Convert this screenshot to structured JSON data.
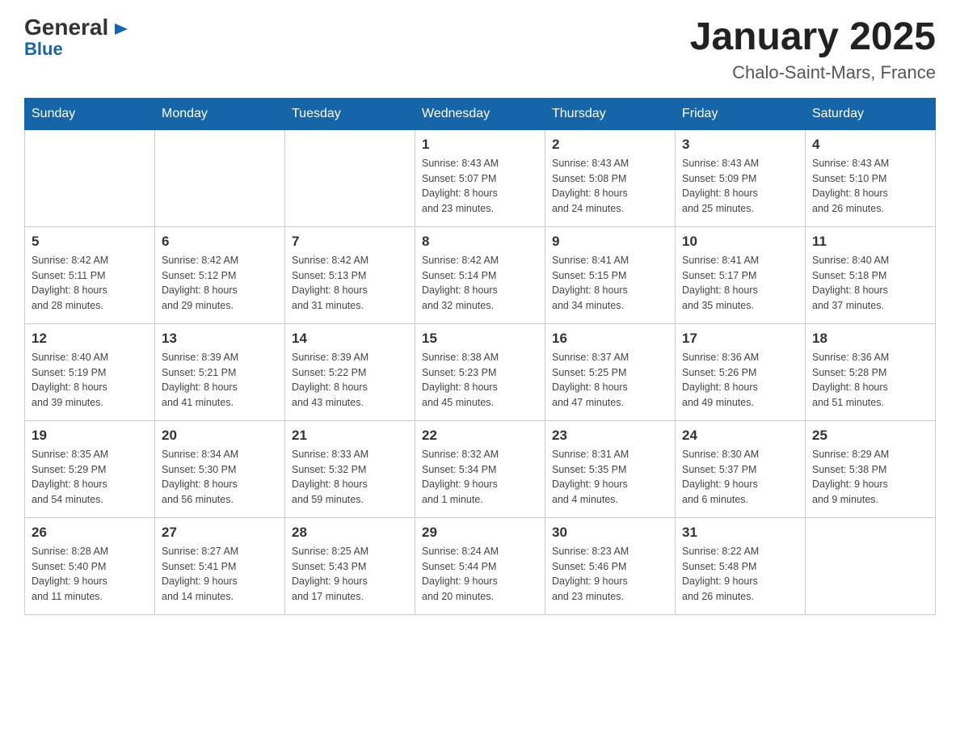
{
  "logo": {
    "general": "General",
    "blue": "Blue",
    "triangle": "▲"
  },
  "title": "January 2025",
  "location": "Chalo-Saint-Mars, France",
  "days_of_week": [
    "Sunday",
    "Monday",
    "Tuesday",
    "Wednesday",
    "Thursday",
    "Friday",
    "Saturday"
  ],
  "weeks": [
    [
      {
        "day": "",
        "info": ""
      },
      {
        "day": "",
        "info": ""
      },
      {
        "day": "",
        "info": ""
      },
      {
        "day": "1",
        "info": "Sunrise: 8:43 AM\nSunset: 5:07 PM\nDaylight: 8 hours\nand 23 minutes."
      },
      {
        "day": "2",
        "info": "Sunrise: 8:43 AM\nSunset: 5:08 PM\nDaylight: 8 hours\nand 24 minutes."
      },
      {
        "day": "3",
        "info": "Sunrise: 8:43 AM\nSunset: 5:09 PM\nDaylight: 8 hours\nand 25 minutes."
      },
      {
        "day": "4",
        "info": "Sunrise: 8:43 AM\nSunset: 5:10 PM\nDaylight: 8 hours\nand 26 minutes."
      }
    ],
    [
      {
        "day": "5",
        "info": "Sunrise: 8:42 AM\nSunset: 5:11 PM\nDaylight: 8 hours\nand 28 minutes."
      },
      {
        "day": "6",
        "info": "Sunrise: 8:42 AM\nSunset: 5:12 PM\nDaylight: 8 hours\nand 29 minutes."
      },
      {
        "day": "7",
        "info": "Sunrise: 8:42 AM\nSunset: 5:13 PM\nDaylight: 8 hours\nand 31 minutes."
      },
      {
        "day": "8",
        "info": "Sunrise: 8:42 AM\nSunset: 5:14 PM\nDaylight: 8 hours\nand 32 minutes."
      },
      {
        "day": "9",
        "info": "Sunrise: 8:41 AM\nSunset: 5:15 PM\nDaylight: 8 hours\nand 34 minutes."
      },
      {
        "day": "10",
        "info": "Sunrise: 8:41 AM\nSunset: 5:17 PM\nDaylight: 8 hours\nand 35 minutes."
      },
      {
        "day": "11",
        "info": "Sunrise: 8:40 AM\nSunset: 5:18 PM\nDaylight: 8 hours\nand 37 minutes."
      }
    ],
    [
      {
        "day": "12",
        "info": "Sunrise: 8:40 AM\nSunset: 5:19 PM\nDaylight: 8 hours\nand 39 minutes."
      },
      {
        "day": "13",
        "info": "Sunrise: 8:39 AM\nSunset: 5:21 PM\nDaylight: 8 hours\nand 41 minutes."
      },
      {
        "day": "14",
        "info": "Sunrise: 8:39 AM\nSunset: 5:22 PM\nDaylight: 8 hours\nand 43 minutes."
      },
      {
        "day": "15",
        "info": "Sunrise: 8:38 AM\nSunset: 5:23 PM\nDaylight: 8 hours\nand 45 minutes."
      },
      {
        "day": "16",
        "info": "Sunrise: 8:37 AM\nSunset: 5:25 PM\nDaylight: 8 hours\nand 47 minutes."
      },
      {
        "day": "17",
        "info": "Sunrise: 8:36 AM\nSunset: 5:26 PM\nDaylight: 8 hours\nand 49 minutes."
      },
      {
        "day": "18",
        "info": "Sunrise: 8:36 AM\nSunset: 5:28 PM\nDaylight: 8 hours\nand 51 minutes."
      }
    ],
    [
      {
        "day": "19",
        "info": "Sunrise: 8:35 AM\nSunset: 5:29 PM\nDaylight: 8 hours\nand 54 minutes."
      },
      {
        "day": "20",
        "info": "Sunrise: 8:34 AM\nSunset: 5:30 PM\nDaylight: 8 hours\nand 56 minutes."
      },
      {
        "day": "21",
        "info": "Sunrise: 8:33 AM\nSunset: 5:32 PM\nDaylight: 8 hours\nand 59 minutes."
      },
      {
        "day": "22",
        "info": "Sunrise: 8:32 AM\nSunset: 5:34 PM\nDaylight: 9 hours\nand 1 minute."
      },
      {
        "day": "23",
        "info": "Sunrise: 8:31 AM\nSunset: 5:35 PM\nDaylight: 9 hours\nand 4 minutes."
      },
      {
        "day": "24",
        "info": "Sunrise: 8:30 AM\nSunset: 5:37 PM\nDaylight: 9 hours\nand 6 minutes."
      },
      {
        "day": "25",
        "info": "Sunrise: 8:29 AM\nSunset: 5:38 PM\nDaylight: 9 hours\nand 9 minutes."
      }
    ],
    [
      {
        "day": "26",
        "info": "Sunrise: 8:28 AM\nSunset: 5:40 PM\nDaylight: 9 hours\nand 11 minutes."
      },
      {
        "day": "27",
        "info": "Sunrise: 8:27 AM\nSunset: 5:41 PM\nDaylight: 9 hours\nand 14 minutes."
      },
      {
        "day": "28",
        "info": "Sunrise: 8:25 AM\nSunset: 5:43 PM\nDaylight: 9 hours\nand 17 minutes."
      },
      {
        "day": "29",
        "info": "Sunrise: 8:24 AM\nSunset: 5:44 PM\nDaylight: 9 hours\nand 20 minutes."
      },
      {
        "day": "30",
        "info": "Sunrise: 8:23 AM\nSunset: 5:46 PM\nDaylight: 9 hours\nand 23 minutes."
      },
      {
        "day": "31",
        "info": "Sunrise: 8:22 AM\nSunset: 5:48 PM\nDaylight: 9 hours\nand 26 minutes."
      },
      {
        "day": "",
        "info": ""
      }
    ]
  ]
}
